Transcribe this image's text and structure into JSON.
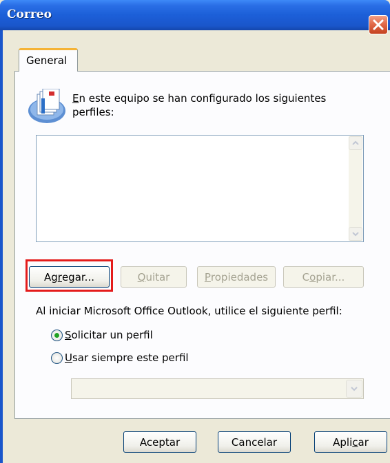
{
  "window": {
    "title": "Correo"
  },
  "tabs": [
    {
      "label": "General"
    }
  ],
  "intro": {
    "accel": "E",
    "rest": "n este equipo se han configurado los siguientes perfiles:"
  },
  "profiles_list": {
    "items": []
  },
  "profile_buttons": [
    {
      "pre": "Ag",
      "accel": "r",
      "post": "egar...",
      "disabled": false
    },
    {
      "pre": "",
      "accel": "Q",
      "post": "uitar",
      "disabled": true
    },
    {
      "pre": "",
      "accel": "P",
      "post": "ropiedades",
      "disabled": true
    },
    {
      "pre": "C",
      "accel": "o",
      "post": "piar...",
      "disabled": true
    }
  ],
  "startup": {
    "label": "Al iniciar Microsoft Office Outlook, utilice el siguiente perfil:",
    "options": [
      {
        "accel": "S",
        "rest": "olicitar un perfil",
        "selected": true
      },
      {
        "accel": "U",
        "rest": "sar siempre este perfil",
        "selected": false
      }
    ],
    "profile_combo_value": ""
  },
  "dialog_buttons": {
    "ok": "Aceptar",
    "cancel": "Cancelar",
    "apply": {
      "pre": "Apli",
      "accel": "c",
      "post": "ar"
    }
  },
  "colors": {
    "highlight": "#e41b1b",
    "radio_dot": "#21a121",
    "titlebar": "#1c5fd8"
  }
}
